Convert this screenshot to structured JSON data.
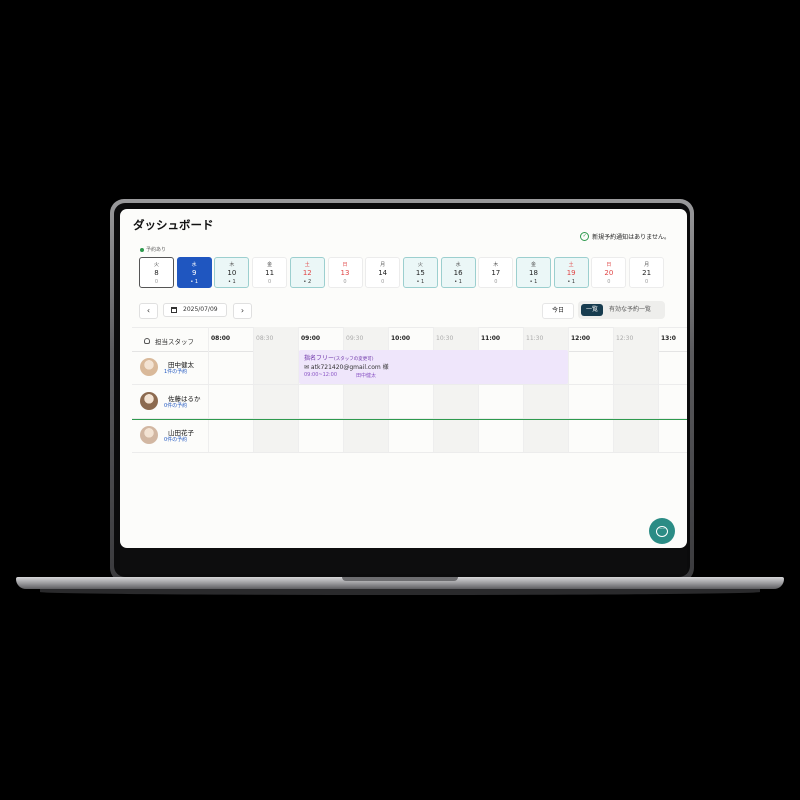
{
  "dashboard": {
    "title": "ダッシュボード",
    "notice": "新規予約通知はありません。",
    "legend": "予約あり"
  },
  "days": [
    {
      "weekday": "火",
      "date": "8",
      "count": "0",
      "has": false,
      "selected": false,
      "holiday": false,
      "today": true
    },
    {
      "weekday": "水",
      "date": "9",
      "count": "• 1",
      "has": true,
      "selected": true,
      "holiday": false,
      "today": false
    },
    {
      "weekday": "木",
      "date": "10",
      "count": "• 1",
      "has": true,
      "selected": false,
      "holiday": false,
      "today": false
    },
    {
      "weekday": "金",
      "date": "11",
      "count": "0",
      "has": false,
      "selected": false,
      "holiday": false,
      "today": false
    },
    {
      "weekday": "土",
      "date": "12",
      "count": "• 2",
      "has": true,
      "selected": false,
      "holiday": true,
      "today": false
    },
    {
      "weekday": "日",
      "date": "13",
      "count": "0",
      "has": false,
      "selected": false,
      "holiday": true,
      "today": false
    },
    {
      "weekday": "月",
      "date": "14",
      "count": "0",
      "has": false,
      "selected": false,
      "holiday": false,
      "today": false
    },
    {
      "weekday": "火",
      "date": "15",
      "count": "• 1",
      "has": true,
      "selected": false,
      "holiday": false,
      "today": false
    },
    {
      "weekday": "水",
      "date": "16",
      "count": "• 1",
      "has": true,
      "selected": false,
      "holiday": false,
      "today": false
    },
    {
      "weekday": "木",
      "date": "17",
      "count": "0",
      "has": false,
      "selected": false,
      "holiday": false,
      "today": false
    },
    {
      "weekday": "金",
      "date": "18",
      "count": "• 1",
      "has": true,
      "selected": false,
      "holiday": false,
      "today": false
    },
    {
      "weekday": "土",
      "date": "19",
      "count": "• 1",
      "has": true,
      "selected": false,
      "holiday": true,
      "today": false
    },
    {
      "weekday": "日",
      "date": "20",
      "count": "0",
      "has": false,
      "selected": false,
      "holiday": true,
      "today": false
    },
    {
      "weekday": "月",
      "date": "21",
      "count": "0",
      "has": false,
      "selected": false,
      "holiday": false,
      "today": false
    }
  ],
  "toolbar": {
    "prev": "‹",
    "next": "›",
    "date": "2025/07/09",
    "today": "今日",
    "view_list": "一覧",
    "view_valid": "有効な予約一覧"
  },
  "schedule": {
    "staff_header": "担当スタッフ",
    "times": [
      {
        "label": "08:00",
        "half": false
      },
      {
        "label": "08:30",
        "half": true
      },
      {
        "label": "09:00",
        "half": false
      },
      {
        "label": "09:30",
        "half": true
      },
      {
        "label": "10:00",
        "half": false
      },
      {
        "label": "10:30",
        "half": true
      },
      {
        "label": "11:00",
        "half": false
      },
      {
        "label": "11:30",
        "half": true
      },
      {
        "label": "12:00",
        "half": false
      },
      {
        "label": "12:30",
        "half": true
      },
      {
        "label": "13:0",
        "half": false
      }
    ],
    "staff": [
      {
        "name": "田中健太",
        "count": "1件の予約",
        "avatar": "#d9b99a"
      },
      {
        "name": "佐藤はるか",
        "count": "0件の予約",
        "avatar": "#8c6a4f"
      },
      {
        "name": "山田花子",
        "count": "0件の予約",
        "avatar": "#d2b7a2"
      }
    ],
    "appointment": {
      "title": "指名フリー",
      "note": "(スタッフの変更可)",
      "email": "✉ atk721420@gmail.com 様",
      "time": "09:00~12:00",
      "staff": "田中健太"
    }
  },
  "colors": {
    "accent": "#1f56c0",
    "appointment": "#efe6fb",
    "chat": "#2b8c85",
    "has_reservation": "#ebf7f7"
  }
}
